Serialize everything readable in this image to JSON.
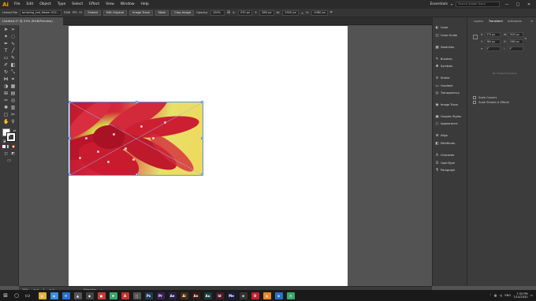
{
  "app": {
    "logo": "Ai",
    "menu": [
      "File",
      "Edit",
      "Object",
      "Type",
      "Select",
      "Effect",
      "View",
      "Window",
      "Help"
    ],
    "workspace": "Essentials",
    "search_placeholder": "Search Adobe Stock",
    "window_controls": [
      "—",
      "□",
      "✕"
    ]
  },
  "control_bar": {
    "selection_label": "Linked File",
    "file_name": "amazing_red_flower 022...",
    "color_mode": "RGB",
    "ppi": "PPI: 72",
    "embed": "Embed",
    "edit_original": "Edit Original",
    "image_trace": "Image Trace",
    "mask": "Mask",
    "crop_image": "Crop Image",
    "opacity_label": "Opacity:",
    "opacity_value": "100%",
    "x_label": "X:",
    "x_value": "370 px",
    "y_label": "Y:",
    "y_value": "380 px",
    "w_label": "W:",
    "w_value": "1920 px",
    "h_label": "H:",
    "h_value": "1080 px"
  },
  "document_tab": "Untitled-1* @ 25% (RGB/Preview)",
  "panels_strip": {
    "items": [
      {
        "icon": "color-icon",
        "glyph": "◐",
        "label": "Color"
      },
      {
        "icon": "color-guide-icon",
        "glyph": "◫",
        "label": "Color Guide"
      },
      {
        "icon": "swatches-icon",
        "glyph": "▦",
        "label": "Swatches"
      },
      {
        "icon": "brushes-icon",
        "glyph": "✎",
        "label": "Brushes"
      },
      {
        "icon": "symbols-icon",
        "glyph": "♣",
        "label": "Symbols"
      },
      {
        "icon": "stroke-icon",
        "glyph": "≡",
        "label": "Stroke"
      },
      {
        "icon": "gradient-icon",
        "glyph": "▭",
        "label": "Gradient"
      },
      {
        "icon": "transparency-icon",
        "glyph": "◎",
        "label": "Transparency"
      },
      {
        "icon": "image-trace-icon",
        "glyph": "◉",
        "label": "Image Trace"
      },
      {
        "icon": "graphic-styles-icon",
        "glyph": "▣",
        "label": "Graphic Styles"
      },
      {
        "icon": "appearance-icon",
        "glyph": "○",
        "label": "Appearance"
      },
      {
        "icon": "align-icon",
        "glyph": "⊟",
        "label": "Align"
      },
      {
        "icon": "pathfinder-icon",
        "glyph": "◧",
        "label": "Pathfinder"
      },
      {
        "icon": "character-icon",
        "glyph": "A",
        "label": "Character"
      },
      {
        "icon": "opentype-icon",
        "glyph": "O",
        "label": "OpenType"
      },
      {
        "icon": "paragraph-icon",
        "glyph": "¶",
        "label": "Paragraph"
      }
    ]
  },
  "transform_panel": {
    "tabs": [
      "Layers",
      "Transform",
      "Artboards"
    ],
    "active_tab": "Transform",
    "x_label": "X:",
    "x_value": "370 px",
    "y_label": "Y:",
    "y_value": "380 px",
    "w_label": "W:",
    "w_value": "1920 px",
    "h_label": "H:",
    "h_value": "1080 px",
    "angle_value": "0°",
    "shear_value": "0°",
    "no_shape": "No Shape Properties",
    "scale_corners": "Scale Corners",
    "scale_strokes": "Scale Strokes & Effects"
  },
  "status_bar": {
    "zoom": "25%",
    "page": "1",
    "tool": "Selection"
  },
  "taskbar": {
    "apps": [
      {
        "name": "file-explorer",
        "glyph": "▤",
        "color": "#e2b23a"
      },
      {
        "name": "store",
        "glyph": "◈",
        "color": "#3a8ee6"
      },
      {
        "name": "mail",
        "glyph": "✉",
        "color": "#2a6fcf"
      },
      {
        "name": "app-4",
        "glyph": "▲",
        "color": "#555555"
      },
      {
        "name": "app-5",
        "glyph": "◆",
        "color": "#444444"
      },
      {
        "name": "app-6",
        "glyph": "●",
        "color": "#c83a3a"
      },
      {
        "name": "app-7",
        "glyph": "✚",
        "color": "#3aa86a"
      },
      {
        "name": "acrobat",
        "glyph": "A",
        "color": "#c9302c"
      },
      {
        "name": "app-9",
        "glyph": "◻",
        "color": "#555555"
      },
      {
        "name": "app-10",
        "glyph": "Ps",
        "color": "#1f3b5a"
      },
      {
        "name": "premiere",
        "glyph": "Pr",
        "color": "#3a1f5a"
      },
      {
        "name": "after-effects",
        "glyph": "Ae",
        "color": "#2a1f4a"
      },
      {
        "name": "illustrator",
        "glyph": "Ai",
        "color": "#4a2a10"
      },
      {
        "name": "animate",
        "glyph": "An",
        "color": "#3a1a10"
      },
      {
        "name": "audition",
        "glyph": "Au",
        "color": "#1a3a3a"
      },
      {
        "name": "indesign",
        "glyph": "Id",
        "color": "#4a1a2a"
      },
      {
        "name": "media-encoder",
        "glyph": "Me",
        "color": "#1a1a4a"
      },
      {
        "name": "app-18",
        "glyph": "⊕",
        "color": "#333333"
      },
      {
        "name": "opera",
        "glyph": "O",
        "color": "#c81e2e"
      },
      {
        "name": "firefox",
        "glyph": "◍",
        "color": "#e8862a"
      },
      {
        "name": "app-21",
        "glyph": "≋",
        "color": "#2a6fcf"
      },
      {
        "name": "chrome",
        "glyph": "◔",
        "color": "#3aa86a"
      }
    ],
    "tray": {
      "lang": "ENG",
      "time": "7:33 PM",
      "date": "7/10/2020"
    }
  },
  "colors": {
    "accent": "#ff9a00",
    "selection": "#5b8ff0"
  }
}
